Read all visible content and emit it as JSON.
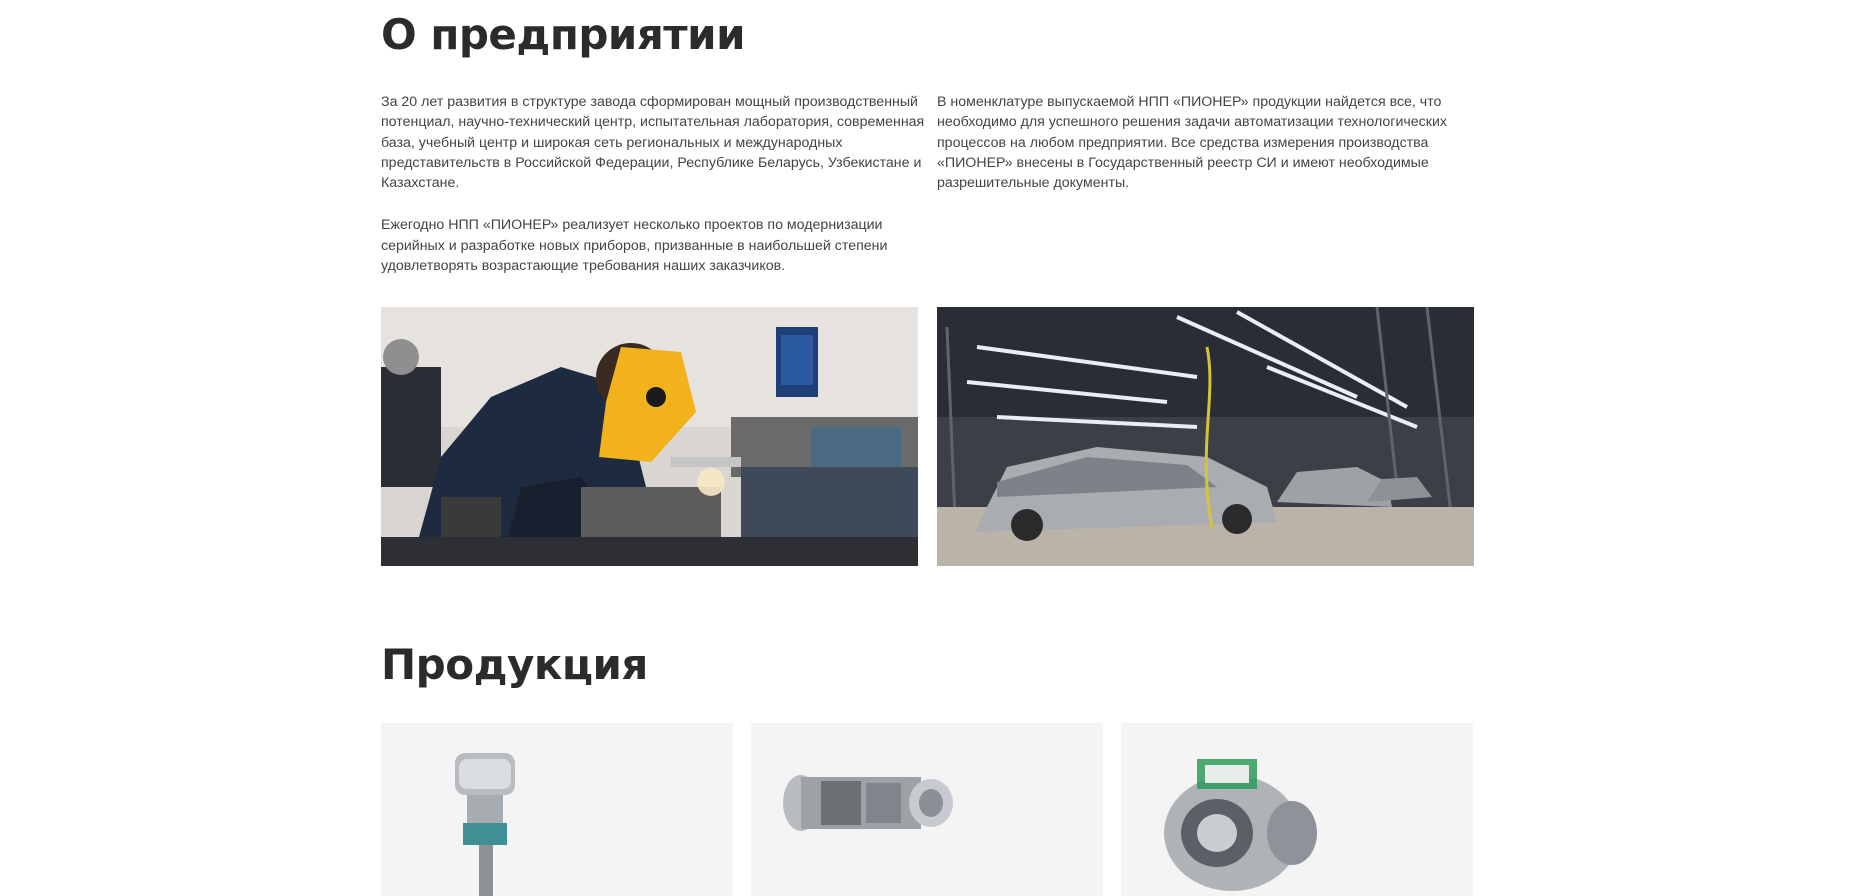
{
  "about": {
    "title": "О предприятии",
    "left_paragraphs": [
      "За 20 лет развития в структуре завода сформирован мощный производственный потенциал, научно-технический центр, испытательная лаборатория, современная база, учебный центр и широкая сеть региональных и международных представительств в Российской Федерации, Республике Беларусь, Узбекистане и Казахстане.",
      "Ежегодно НПП «ПИОНЕР» реализует несколько проектов по модернизации серийных и разработке новых приборов, призванные в наибольшей степени удовлетворять возрастающие требования наших заказчиков."
    ],
    "right_paragraphs": [
      "В номенклатуре выпускаемой НПП «ПИОНЕР» продукции найдется все, что необходимо для успешного решения задачи автоматизации технологических процессов на любом предприятии. Все средства измерения производства «ПИОНЕР» внесены в Государственный реестр СИ и имеют необходимые разрешительные документы."
    ]
  },
  "products": {
    "title": "Продукция"
  },
  "colors": {
    "heading": "#2b2b2b",
    "body_text": "#444444",
    "card_bg": "#f4f4f4",
    "helmet_accent": "#f2b21b"
  }
}
